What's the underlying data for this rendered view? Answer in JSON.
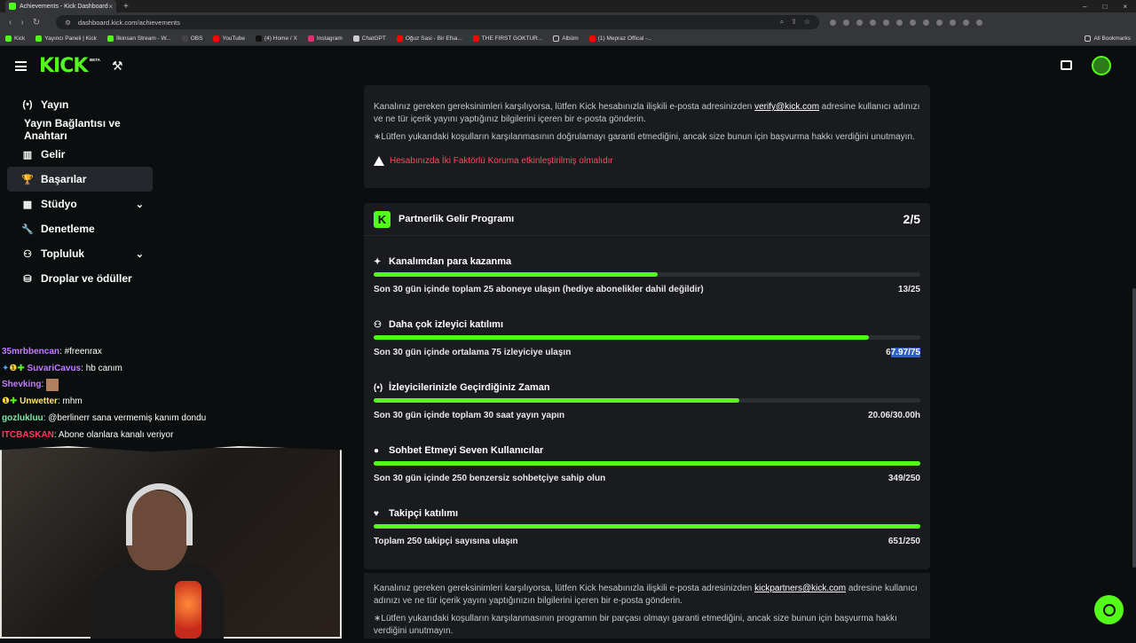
{
  "browser": {
    "tab_title": "Achievements - Kick Dashboard",
    "url": "dashboard.kick.com/achievements",
    "bookmarks": [
      "Kick",
      "Yayıncı Paneli | Kick",
      "İlkinsan Stream - W...",
      "OBS",
      "YouTube",
      "(4) Home / X",
      "Instagram",
      "ChatGPT",
      "Oğuz Sasi - Bir Efsa...",
      "THE FIRST GOKTUR...",
      "Albüm",
      "(1) Mepraz Offical -..."
    ],
    "all_bookmarks": "All Bookmarks"
  },
  "header": {
    "logo": "KICK",
    "beta": "BETA"
  },
  "sidebar": {
    "items": [
      {
        "label": "Yayın",
        "icon": "broadcast-icon"
      },
      {
        "label": "Yayın Bağlantısı ve Anahtarı",
        "icon": ""
      },
      {
        "label": "Gelir",
        "icon": "revenue-icon"
      },
      {
        "label": "Başarılar",
        "icon": "trophy-icon"
      },
      {
        "label": "Stüdyo",
        "icon": "studio-icon"
      },
      {
        "label": "Denetleme",
        "icon": "wrench-icon"
      },
      {
        "label": "Topluluk",
        "icon": "community-icon"
      },
      {
        "label": "Droplar ve ödüller",
        "icon": "gift-icon"
      }
    ]
  },
  "chat": [
    {
      "user": "35mrbbencan",
      "color": "#c37bff",
      "msg": "#freenrax"
    },
    {
      "user": "SuvariCavus",
      "color": "#c37bff",
      "msg": "hb canım"
    },
    {
      "user": "Shevking",
      "color": "#c37bff",
      "msg": ""
    },
    {
      "user": "Unwetter",
      "color": "#ffe07a",
      "msg": "mhm"
    },
    {
      "user": "gozlukluu",
      "color": "#7ee8a8",
      "msg": "@berlinerr sana vermemiş kanım dondu"
    },
    {
      "user": "ITCBASKAN",
      "color": "#ff3b5c",
      "msg": "Abone olanlara kanalı veriyor"
    }
  ],
  "card1": {
    "para1_pre": "Kanalınız gereken gereksinimleri karşılıyorsa, lütfen Kick hesabınızla ilişkili e-posta adresinizden ",
    "para1_link": "verify@kick.com",
    "para1_post": " adresine kullanıcı adınızı ve ne tür içerik yayını yaptığınız bilgilerini içeren bir e-posta gönderin.",
    "para2": "∗Lütfen yukarıdaki koşulların karşılanmasının doğrulamayı garanti etmediğini, ancak size bunun için başvurma hakkı verdiğini unutmayın.",
    "warning": "Hesabınızda İki Faktörlü Koruma etkinleştirilmiş olmalıdır"
  },
  "program": {
    "title": "Partnerlik Gelir Programı",
    "count": "2/5",
    "requirements": [
      {
        "title": "Kanalımdan para kazanma",
        "icon": "sparkle-icon",
        "desc": "Son 30 gün içinde toplam 25 aboneye ulaşın (hediye abonelikler dahil değildir)",
        "value_pre": "",
        "value_sel": "",
        "value": "13/25",
        "progress": 0.52
      },
      {
        "title": "Daha çok izleyici katılımı",
        "icon": "viewers-icon",
        "desc": "Son 30 gün içinde ortalama 75 izleyiciye ulaşın",
        "value_pre": "6",
        "value_sel": "7.97/75",
        "value": "",
        "progress": 0.906
      },
      {
        "title": "İzleyicilerinizle Geçirdiğiniz Zaman",
        "icon": "broadcast-icon",
        "desc": "Son 30 gün içinde toplam 30 saat yayın yapın",
        "value_pre": "",
        "value_sel": "",
        "value": "20.06/30.00h",
        "progress": 0.669
      },
      {
        "title": "Sohbet Etmeyi Seven Kullanıcılar",
        "icon": "chat-icon",
        "desc": "Son 30 gün içinde 250 benzersiz sohbetçiye sahip olun",
        "value_pre": "",
        "value_sel": "",
        "value": "349/250",
        "progress": 1.0
      },
      {
        "title": "Takipçi katılımı",
        "icon": "heart-icon",
        "desc": "Toplam 250 takipçi sayısına ulaşın",
        "value_pre": "",
        "value_sel": "",
        "value": "651/250",
        "progress": 1.0
      }
    ]
  },
  "footer": {
    "para1_pre": "Kanalınız gereken gereksinimleri karşılıyorsa, lütfen Kick hesabınızla ilişkili e-posta adresinizden ",
    "para1_link": "kickpartners@kick.com",
    "para1_post": " adresine kullanıcı adınızı ve ne tür içerik yayını yaptığınızın bilgilerini içeren bir e-posta gönderin.",
    "para2": "∗Lütfen yukarıdaki koşulların karşılanmasının programın bir parçası olmayı garanti etmediğini, ancak size bunun için başvurma hakkı verdiğini unutmayın."
  },
  "colors": {
    "accent": "#53fc18",
    "warning": "#ff4a5c",
    "card": "#191b1f",
    "bg": "#0b0e0f"
  }
}
